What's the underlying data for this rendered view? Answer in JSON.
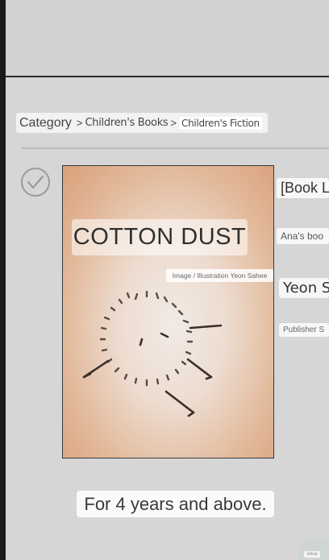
{
  "breadcrumb": {
    "category": "Category",
    "separator1": ">",
    "level1": "Children's Books",
    "separator2": ">",
    "level2": "Children's Fiction"
  },
  "book": {
    "cover_title": "COTTON DUST",
    "cover_credit": "Image / Illustration Yeon Sahee",
    "series_label": "[Book L",
    "publisher_label": "Ana's boo",
    "author_label": "Yeon Sa",
    "publisher_info_label": "Publisher S",
    "age_label": "For 4 years and above."
  },
  "icons": {
    "check": "checkmark-circle-icon",
    "cover_art": "cotton-dust-character-illustration"
  },
  "colors": {
    "background": "#d6d6d6",
    "bezel": "#1a1a1a",
    "cover_orange": "#d9a07a"
  },
  "watermark": {
    "text": "Infinal"
  }
}
